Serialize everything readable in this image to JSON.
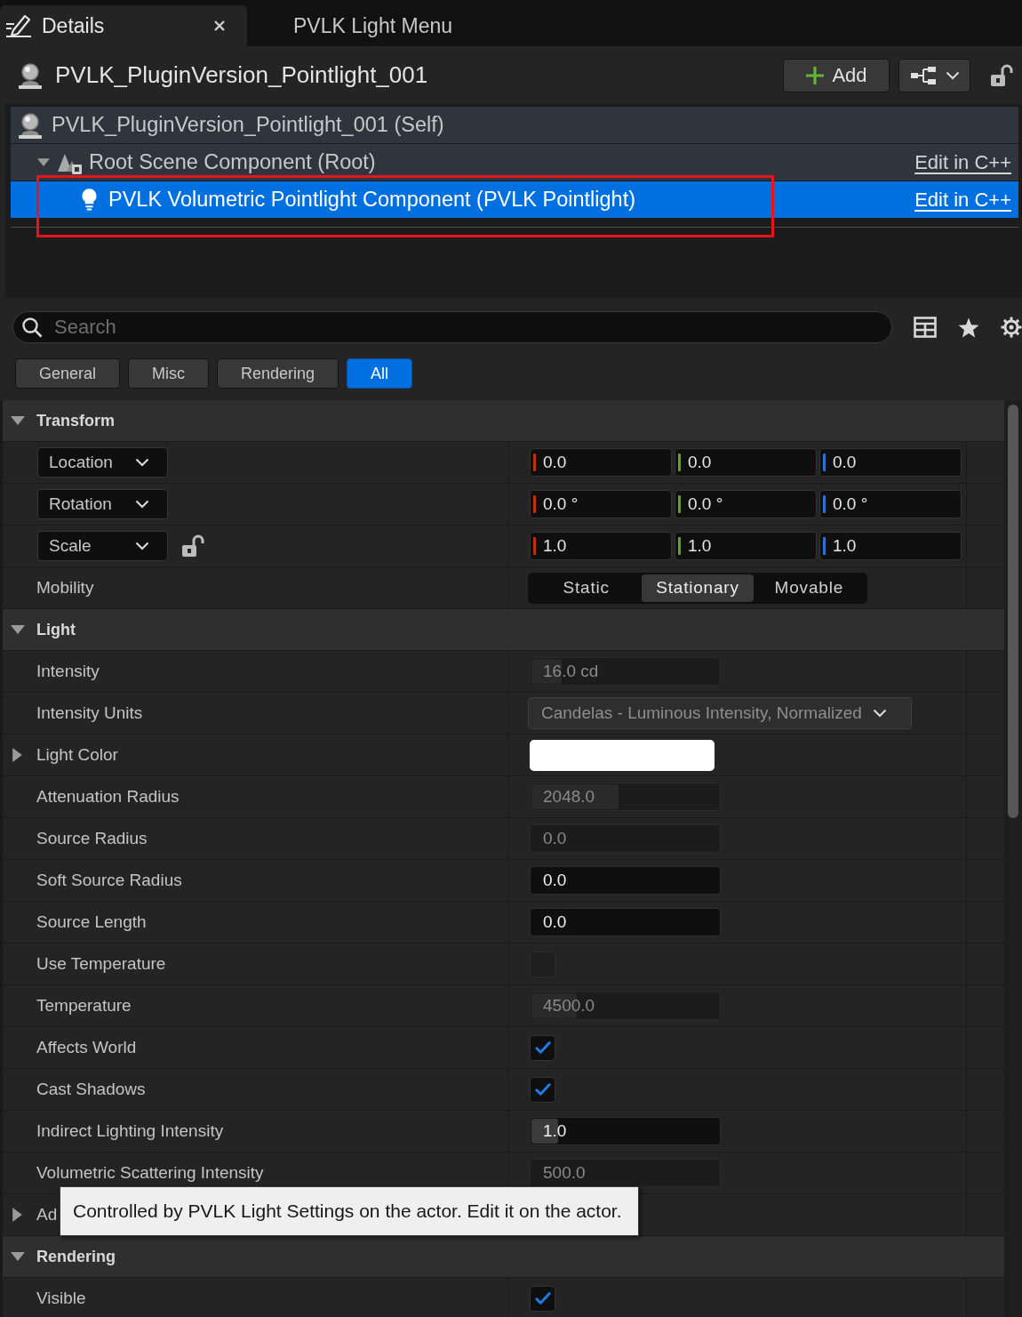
{
  "tabs": [
    {
      "label": "Details",
      "kind": "panel",
      "selected": true,
      "closable": true
    },
    {
      "label": "PVLK Light Menu",
      "kind": "plain",
      "selected": false,
      "closable": false
    }
  ],
  "actor": {
    "name": "PVLK_PluginVersion_Pointlight_001",
    "add_button": "Add",
    "locked": false
  },
  "components": {
    "self_row": {
      "label": "PVLK_PluginVersion_Pointlight_001 (Self)",
      "selected": false
    },
    "tree": [
      {
        "label": "Root Scene Component (Root)",
        "kind": "scene",
        "link": "Edit in C++",
        "selected": false,
        "annotated": false,
        "expanded": true,
        "children": [
          {
            "label": "PVLK Volumetric Pointlight Component (PVLK Pointlight)",
            "kind": "light",
            "link": "Edit in C++",
            "selected": true,
            "annotated": true
          }
        ]
      }
    ]
  },
  "search": {
    "placeholder": "Search"
  },
  "filters": [
    {
      "label": "General",
      "selected": false
    },
    {
      "label": "Misc",
      "selected": false
    },
    {
      "label": "Rendering",
      "selected": false
    },
    {
      "label": "All",
      "selected": true
    }
  ],
  "sections": [
    {
      "title": "Transform",
      "expanded": true,
      "rows": [
        {
          "kind": "vector",
          "label": "Location",
          "values": [
            "0.0",
            "0.0",
            "0.0"
          ]
        },
        {
          "kind": "vector",
          "label": "Rotation",
          "values": [
            "0.0 °",
            "0.0 °",
            "0.0 °"
          ]
        },
        {
          "kind": "vector",
          "label": "Scale",
          "values": [
            "1.0",
            "1.0",
            "1.0"
          ],
          "ratio_locked": false
        },
        {
          "kind": "segmented",
          "label": "Mobility",
          "options": [
            {
              "label": "Static",
              "selected": false
            },
            {
              "label": "Stationary",
              "selected": true
            },
            {
              "label": "Movable",
              "selected": false
            }
          ]
        }
      ]
    },
    {
      "title": "Light",
      "expanded": true,
      "rows": [
        {
          "kind": "number",
          "label": "Intensity",
          "value": "16.0 cd",
          "disabled": true,
          "level": 0.16
        },
        {
          "kind": "dropdown",
          "label": "Intensity Units",
          "value": "Candelas - Luminous Intensity, Normalized",
          "disabled": true
        },
        {
          "kind": "color",
          "label": "Light Color",
          "color": "#ffffff",
          "expanded": false
        },
        {
          "kind": "number",
          "label": "Attenuation Radius",
          "value": "2048.0",
          "disabled": true,
          "level": 0.46
        },
        {
          "kind": "number",
          "label": "Source Radius",
          "value": "0.0",
          "disabled": true
        },
        {
          "kind": "number",
          "label": "Soft Source Radius",
          "value": "0.0",
          "disabled": false
        },
        {
          "kind": "number",
          "label": "Source Length",
          "value": "0.0",
          "disabled": false
        },
        {
          "kind": "checkbox",
          "label": "Use Temperature",
          "checked": false,
          "disabled": true
        },
        {
          "kind": "number",
          "label": "Temperature",
          "value": "4500.0",
          "disabled": true,
          "level": 0.24
        },
        {
          "kind": "checkbox",
          "label": "Affects World",
          "checked": true,
          "disabled": false
        },
        {
          "kind": "checkbox",
          "label": "Cast Shadows",
          "checked": true,
          "disabled": false
        },
        {
          "kind": "number",
          "label": "Indirect Lighting Intensity",
          "value": "1.0",
          "disabled": false,
          "level": 0.14
        },
        {
          "kind": "number",
          "label": "Volumetric Scattering Intensity",
          "value": "500.0",
          "disabled": true
        },
        {
          "kind": "group",
          "label": "Ad",
          "expanded": false
        }
      ]
    },
    {
      "title": "Rendering",
      "expanded": true,
      "rows": [
        {
          "kind": "checkbox",
          "label": "Visible",
          "checked": true,
          "disabled": false
        }
      ]
    }
  ],
  "tooltip": {
    "text": "Controlled by PVLK Light Settings on the actor. Edit it on the actor."
  }
}
